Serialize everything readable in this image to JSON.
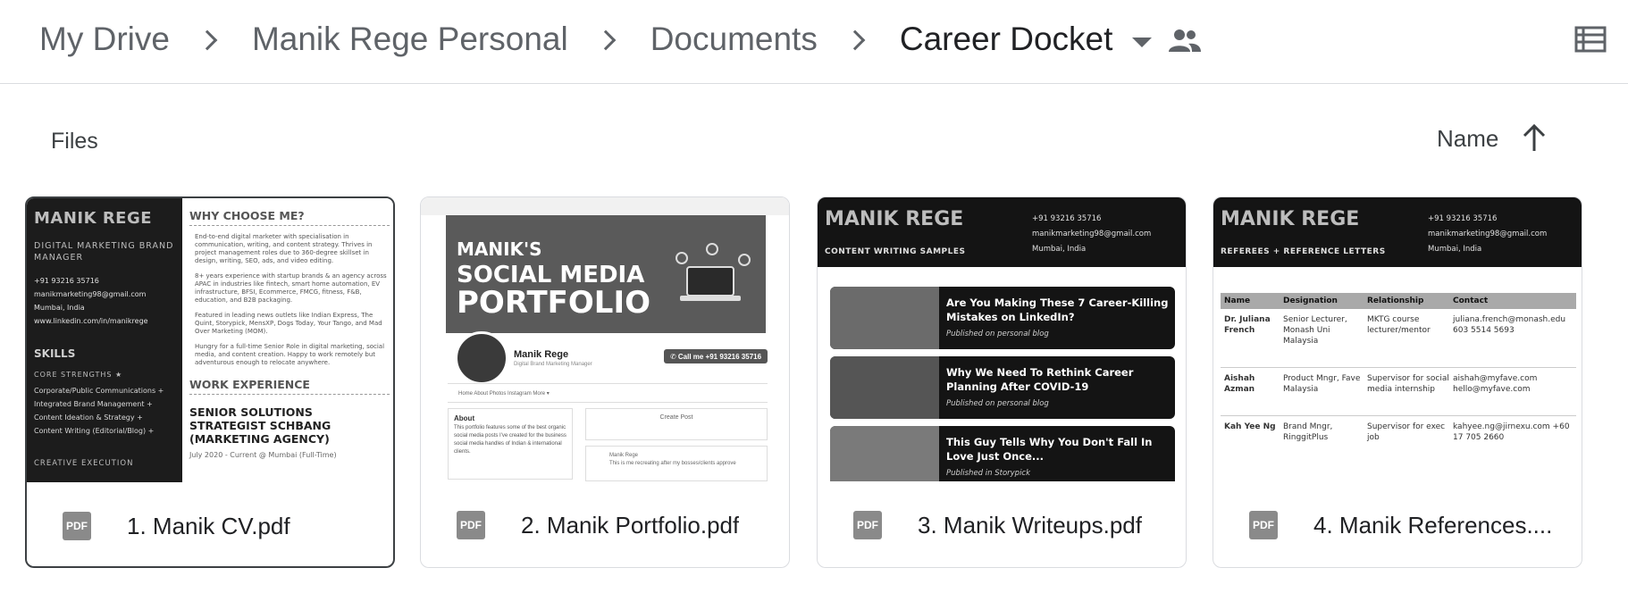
{
  "breadcrumb": {
    "items": [
      "My Drive",
      "Manik Rege Personal",
      "Documents",
      "Career Docket"
    ]
  },
  "section": {
    "title": "Files",
    "sort_label": "Name"
  },
  "files": [
    {
      "name": "1. Manik CV.pdf",
      "type_badge": "PDF"
    },
    {
      "name": "2. Manik Portfolio.pdf",
      "type_badge": "PDF"
    },
    {
      "name": "3. Manik Writeups.pdf",
      "type_badge": "PDF"
    },
    {
      "name": "4. Manik References....",
      "type_badge": "PDF"
    }
  ],
  "thumbs": {
    "cv": {
      "name": "MANIK REGE",
      "role": "DIGITAL MARKETING BRAND MANAGER",
      "phone": "+91 93216 35716",
      "email": "manikmarketing98@gmail.com",
      "location": "Mumbai, India",
      "web": "www.linkedin.com/in/manikrege",
      "skills_heading": "SKILLS",
      "core_heading": "CORE STRENGTHS ★",
      "skills": [
        "Corporate/Public Communications +",
        "Integrated Brand Management +",
        "Content Ideation & Strategy +",
        "Content Writing (Editorial/Blog) +"
      ],
      "creative": "CREATIVE EXECUTION",
      "why_heading": "WHY CHOOSE ME?",
      "bullets": [
        "End-to-end digital marketer with specialisation in communication, writing, and content strategy. Thrives in project management roles due to 360-degree skillset in design, writing, SEO, ads, and video editing.",
        "8+ years experience with startup brands & an agency across APAC in industries like fintech, smart home automation, EV infrastructure, BFSI, Ecommerce, FMCG, fitness, F&B, education, and B2B packaging.",
        "Featured in leading news outlets like Indian Express, The Quint, Storypick, MensXP, Dogs Today, Your Tango, and Mad Over Marketing (MOM).",
        "Hungry for a full-time Senior Role in digital marketing, social media, and content creation. Happy to work remotely but adventurous enough to relocate anywhere."
      ],
      "work_heading": "WORK EXPERIENCE",
      "job": "SENIOR SOLUTIONS STRATEGIST SCHBANG (MARKETING AGENCY)",
      "job_date": "July 2020 - Current @ Mumbai (Full-Time)"
    },
    "portfolio": {
      "line1": "MANIK'S",
      "line2": "SOCIAL MEDIA",
      "line3": "PORTFOLIO",
      "profile_name": "Manik Rege",
      "profile_tag": "Digital Brand Marketing Manager",
      "call": "✆ Call me +91 93216 35716",
      "nav": "Home    About    Photos    Instagram    More ▾",
      "about_title": "About",
      "about_text": "This portfolio features some of the best organic social media posts I've created for the business social media handles of Indian & international clients.",
      "create_post": "Create Post",
      "feed_name": "Manik Rege",
      "feed_text": "This is me recreating after my bosses/clients approve"
    },
    "writeups": {
      "name": "MANIK REGE",
      "subtitle": "CONTENT WRITING SAMPLES",
      "phone": "+91 93216 35716",
      "email": "manikmarketing98@gmail.com",
      "location": "Mumbai, India",
      "items": [
        {
          "title": "Are You Making These 7 Career-Killing Mistakes on LinkedIn?",
          "source": "Published on personal blog"
        },
        {
          "title": "Why We Need To Rethink Career Planning After COVID-19",
          "source": "Published on personal blog"
        },
        {
          "title": "This Guy Tells Why You Don't Fall In Love Just Once...",
          "source": "Published in Storypick"
        }
      ]
    },
    "references": {
      "name": "MANIK REGE",
      "subtitle": "REFEREES + REFERENCE LETTERS",
      "phone": "+91 93216 35716",
      "email": "manikmarketing98@gmail.com",
      "location": "Mumbai, India",
      "headers": [
        "Name",
        "Designation",
        "Relationship",
        "Contact"
      ],
      "rows": [
        [
          "Dr. Juliana French",
          "Senior Lecturer, Monash Uni Malaysia",
          "MKTG course lecturer/mentor",
          "juliana.french@monash.edu 603 5514 5693"
        ],
        [
          "Aishah Azman",
          "Product Mngr, Fave Malaysia",
          "Supervisor for social media internship",
          "aishah@myfave.com hello@myfave.com"
        ],
        [
          "Kah Yee Ng",
          "Brand Mngr, RinggitPlus",
          "Supervisor for exec job",
          "kahyee.ng@jirnexu.com +60 17 705 2660"
        ]
      ]
    }
  }
}
